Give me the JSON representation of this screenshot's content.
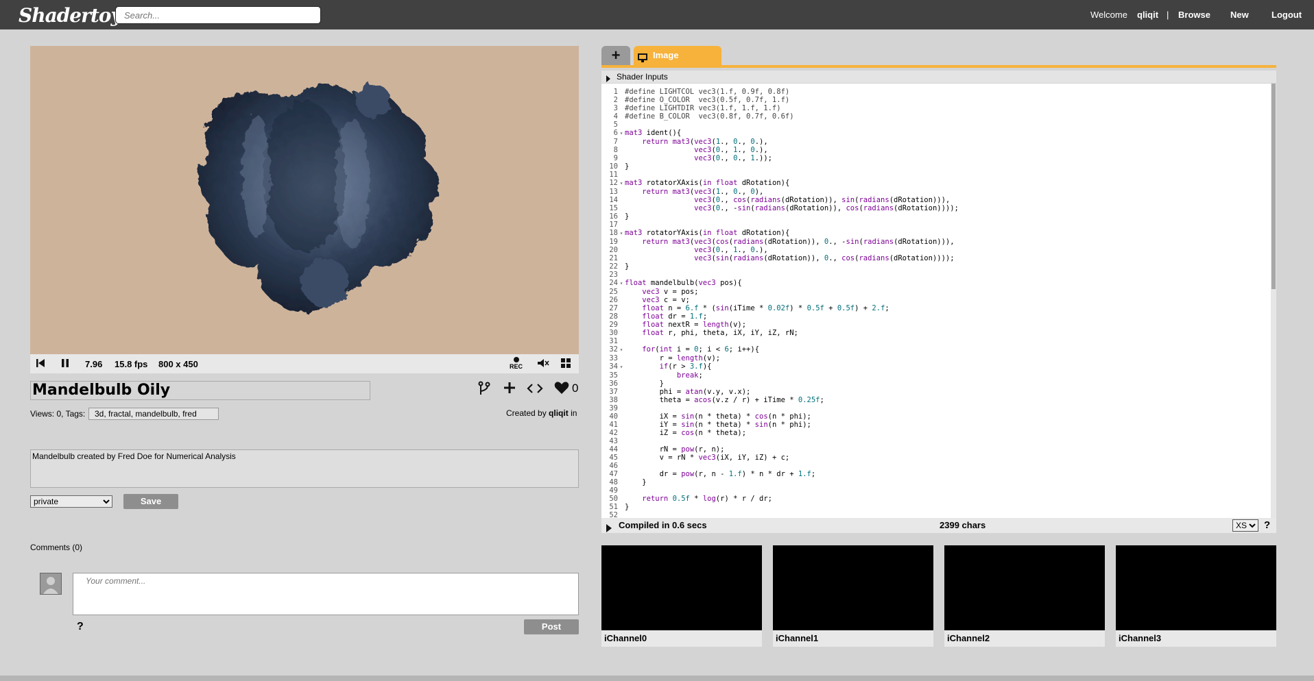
{
  "app": {
    "logo": "Shadertoy"
  },
  "search": {
    "placeholder": "Search..."
  },
  "nav": {
    "welcome": "Welcome",
    "user": "qliqit",
    "separator": "|",
    "browse": "Browse",
    "new": "New",
    "logout": "Logout"
  },
  "player": {
    "time": "7.96",
    "fps": "15.8 fps",
    "resolution": "800 x 450",
    "rec_label": "REC"
  },
  "shader": {
    "title": "Mandelbulb Oily",
    "like_count": "0",
    "views_tags_label": "Views: 0, Tags:",
    "tags": "3d, fractal, mandelbulb, fred",
    "created_by_label": "Created by",
    "author": "qliqit",
    "created_suffix": "in",
    "description": "Mandelbulb created by Fred Doe for Numerical Analysis",
    "privacy": "private",
    "save_label": "Save"
  },
  "comments": {
    "label": "Comments (0)",
    "placeholder": "Your comment...",
    "help": "?",
    "post_label": "Post"
  },
  "editor": {
    "add_tab": "+",
    "tab_label": "Image",
    "inputs_label": "Shader Inputs",
    "status": "Compiled in 0.6 secs",
    "chars": "2399 chars",
    "font_size": "XS",
    "help": "?",
    "lines": [
      "#define LIGHTCOL vec3(1.f, 0.9f, 0.8f)",
      "#define O_COLOR  vec3(0.5f, 0.7f, 1.f)",
      "#define LIGHTDIR vec3(1.f, 1.f, 1.f)",
      "#define B_COLOR  vec3(0.8f, 0.7f, 0.6f)",
      "",
      "mat3 ident(){",
      "    return mat3(vec3(1., 0., 0.),",
      "                vec3(0., 1., 0.),",
      "                vec3(0., 0., 1.));",
      "}",
      "",
      "mat3 rotatorXAxis(in float dRotation){",
      "    return mat3(vec3(1., 0., 0),",
      "                vec3(0., cos(radians(dRotation)), sin(radians(dRotation))),",
      "                vec3(0., -sin(radians(dRotation)), cos(radians(dRotation))));",
      "}",
      "",
      "mat3 rotatorYAxis(in float dRotation){",
      "    return mat3(vec3(cos(radians(dRotation)), 0., -sin(radians(dRotation))),",
      "                vec3(0., 1., 0.),",
      "                vec3(sin(radians(dRotation)), 0., cos(radians(dRotation))));",
      "}",
      "",
      "float mandelbulb(vec3 pos){",
      "    vec3 v = pos;",
      "    vec3 c = v;",
      "    float n = 6.f * (sin(iTime * 0.02f) * 0.5f + 0.5f) + 2.f;",
      "    float dr = 1.f;",
      "    float nextR = length(v);",
      "    float r, phi, theta, iX, iY, iZ, rN;",
      "",
      "    for(int i = 0; i < 6; i++){",
      "        r = length(v);",
      "        if(r > 3.f){",
      "            break;",
      "        }",
      "        phi = atan(v.y, v.x);",
      "        theta = acos(v.z / r) + iTime * 0.25f;",
      "",
      "        iX = sin(n * theta) * cos(n * phi);",
      "        iY = sin(n * theta) * sin(n * phi);",
      "        iZ = cos(n * theta);",
      "",
      "        rN = pow(r, n);",
      "        v = rN * vec3(iX, iY, iZ) + c;",
      "",
      "        dr = pow(r, n - 1.f) * n * dr + 1.f;",
      "    }",
      "",
      "    return 0.5f * log(r) * r / dr;",
      "}",
      ""
    ],
    "fold_lines": [
      6,
      12,
      18,
      24,
      32,
      34
    ]
  },
  "channels": [
    {
      "label": "iChannel0"
    },
    {
      "label": "iChannel1"
    },
    {
      "label": "iChannel2"
    },
    {
      "label": "iChannel3"
    }
  ],
  "colors": {
    "topbar": "#414141",
    "accent_tab": "#f6b23b",
    "canvas_bg": "#ceb39b",
    "keyword": "#7d0096",
    "number": "#00707a"
  }
}
